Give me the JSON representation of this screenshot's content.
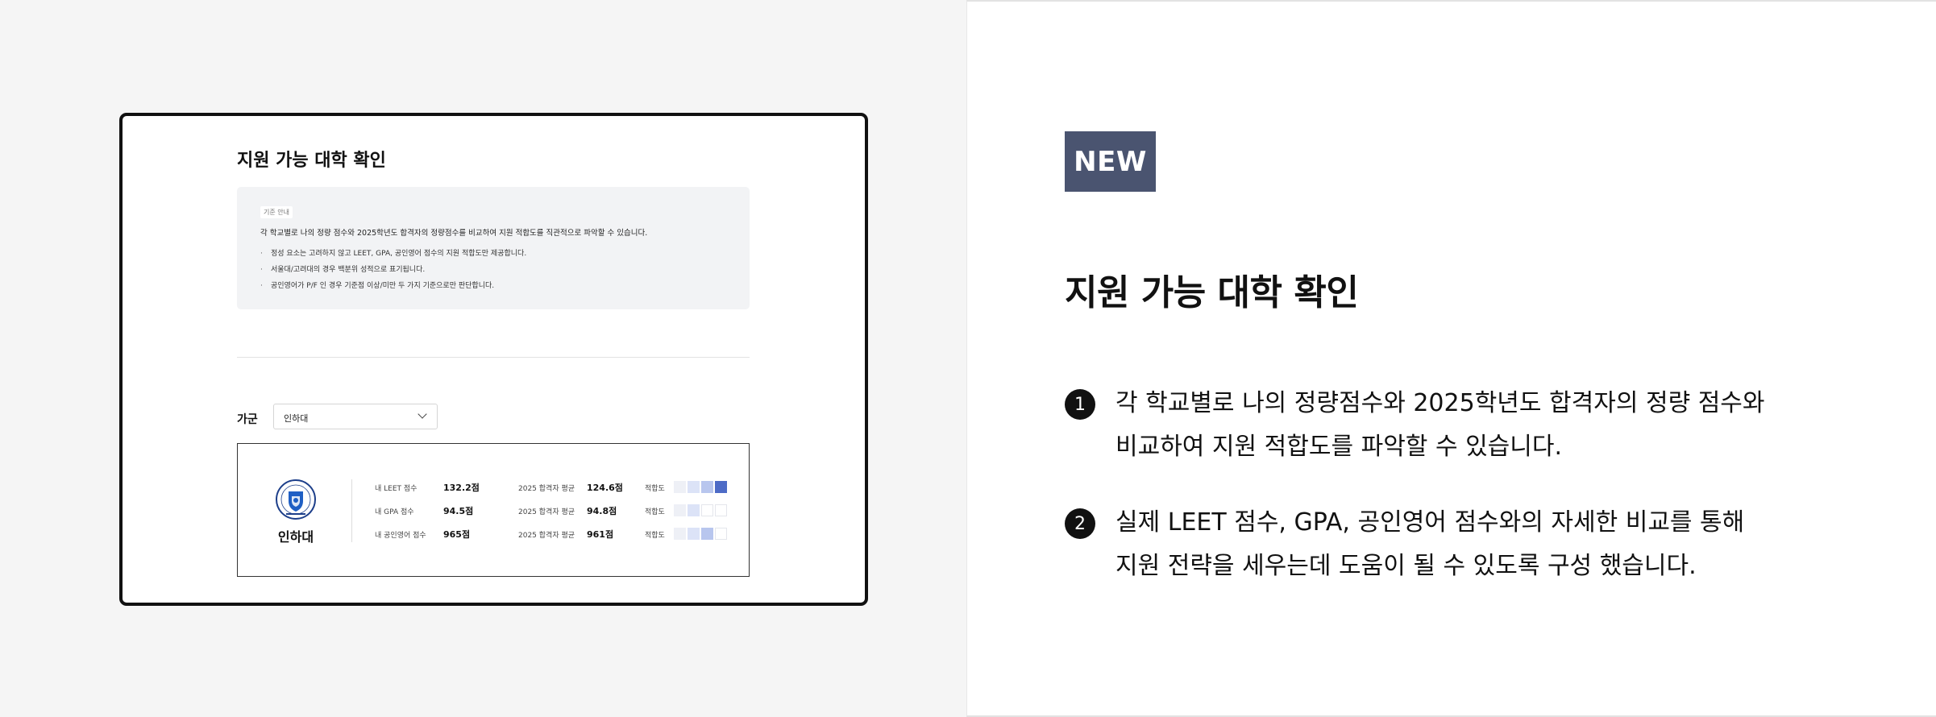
{
  "mockup": {
    "title": "지원 가능 대학 확인",
    "notice": {
      "tag": "기준 안내",
      "main": "각 학교별로 나의 정량 점수와 2025학년도 합격자의 정량점수를 비교하여 지원 적합도를 직관적으로 파악할 수 있습니다.",
      "bullets": [
        "정성 요소는 고려하지 않고 LEET, GPA, 공인영어 점수의 지원 적합도만 제공합니다.",
        "서울대/고려대의 경우 백분위 성적으로 표기됩니다.",
        "공인영어가 P/F 인 경우 기준점 이상/미만 두 가지 기준으로만 판단합니다."
      ]
    },
    "filter": {
      "label": "가군",
      "selected": "인하대"
    },
    "card": {
      "school_name": "인하대",
      "rows": [
        {
          "label": "내 LEET 점수",
          "value": "132.2점",
          "avg_label": "2025 합격자 평균",
          "avg_value": "124.6점",
          "fit_label": "적합도",
          "fit_level": 4
        },
        {
          "label": "내 GPA 점수",
          "value": "94.5점",
          "avg_label": "2025 합격자 평균",
          "avg_value": "94.8점",
          "fit_label": "적합도",
          "fit_level": 2
        },
        {
          "label": "내 공인영어 점수",
          "value": "965점",
          "avg_label": "2025 합격자 평균",
          "avg_value": "961점",
          "fit_label": "적합도",
          "fit_level": 3
        }
      ],
      "fit_max": 4,
      "fit_colors": [
        "#eef0f6",
        "#dce3f7",
        "#b8c6ee",
        "#4d6bc6"
      ]
    }
  },
  "feature": {
    "badge": "NEW",
    "badge_color": "#4a5470",
    "title": "지원 가능 대학 확인",
    "points": [
      {
        "num": "1",
        "lines": [
          "각 학교별로 나의 정량점수와 2025학년도 합격자의 정량 점수와",
          "비교하여 지원 적합도를 파악할 수 있습니다."
        ]
      },
      {
        "num": "2",
        "lines": [
          "실제 LEET 점수, GPA, 공인영어 점수와의 자세한 비교를 통해",
          "지원 전략을 세우는데 도움이 될 수 있도록 구성 했습니다."
        ]
      }
    ]
  }
}
